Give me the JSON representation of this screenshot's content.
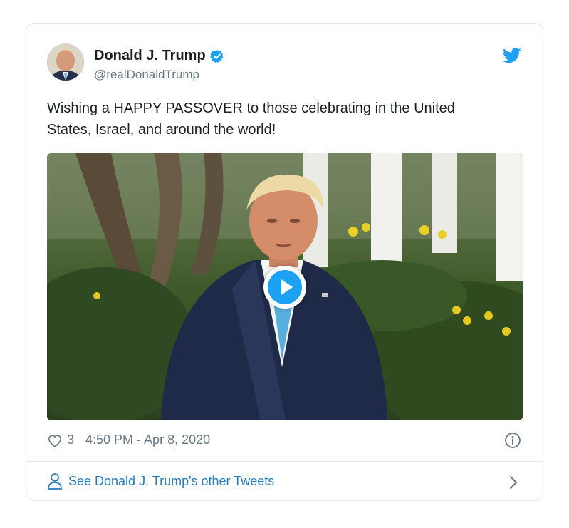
{
  "tweet": {
    "author_name": "Donald J. Trump",
    "handle": "@realDonaldTrump",
    "text": "Wishing a HAPPY PASSOVER to those celebrating in the United States, Israel, and around the world!",
    "like_count": "3",
    "timestamp": "4:50 PM - Apr 8, 2020",
    "footer_link": "See Donald J. Trump's other Tweets"
  },
  "icons": {
    "verified": "verified-badge-icon",
    "brand": "twitter-bird-icon",
    "like": "heart-icon",
    "info": "info-icon",
    "profile": "person-icon",
    "chevron": "chevron-right-icon",
    "play": "play-icon"
  },
  "colors": {
    "accent": "#1da1f2",
    "link": "#2b7bb9",
    "text": "#1c2022",
    "muted": "#697882",
    "border": "#e1e8ed"
  }
}
